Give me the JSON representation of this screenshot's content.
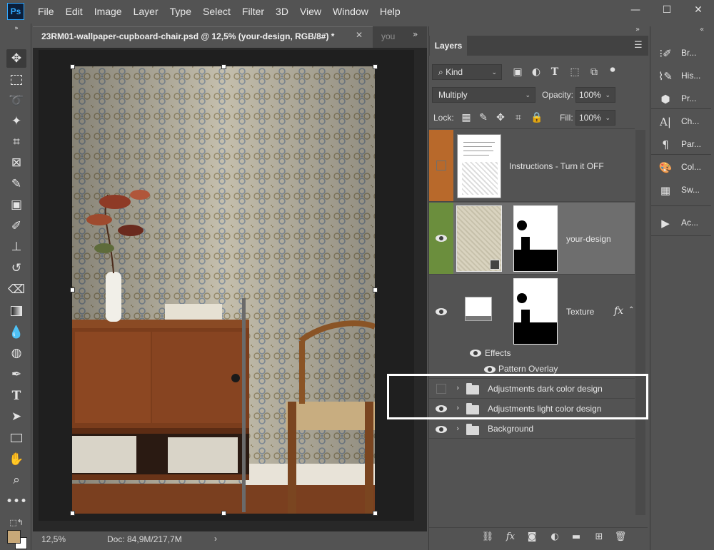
{
  "app": {
    "logo_text": "Ps"
  },
  "menu": [
    "File",
    "Edit",
    "Image",
    "Layer",
    "Type",
    "Select",
    "Filter",
    "3D",
    "View",
    "Window",
    "Help"
  ],
  "window_controls": {
    "minimize": "—",
    "maximize": "☐",
    "close": "✕"
  },
  "document": {
    "tab_title": "23RM01-wallpaper-cupboard-chair.psd @ 12,5% (your-design, RGB/8#) *",
    "tab_close": "✕",
    "second_tab": "yo­u",
    "second_tab_display": "you",
    "zoom": "12,5%",
    "doc_size": "Doc: 84,9M/217,7M",
    "status_arrow": "›"
  },
  "toolbar_icons": [
    "move-icon",
    "marquee-icon",
    "lasso-icon",
    "magic-wand-icon",
    "crop-icon",
    "frame-icon",
    "eyedropper-icon",
    "healing-icon",
    "brush-icon",
    "stamp-icon",
    "history-brush-icon",
    "eraser-icon",
    "gradient-icon",
    "blur-icon",
    "dodge-icon",
    "pen-icon",
    "type-icon",
    "path-select-icon",
    "rectangle-icon",
    "hand-icon",
    "zoom-icon",
    "more-tools-icon"
  ],
  "layers_panel": {
    "tab_label": "Layers",
    "kind_label": "Kind",
    "blend_mode": "Multiply",
    "opacity_label": "Opacity:",
    "opacity_value": "100%",
    "lock_label": "Lock:",
    "fill_label": "Fill:",
    "fill_value": "100%",
    "effects_label": "Effects",
    "pattern_overlay_label": "Pattern Overlay",
    "fx_label": "fx",
    "layers": [
      {
        "name": "Instructions - Turn it OFF",
        "visible": false,
        "color_tag": "#b8692b"
      },
      {
        "name": "your-design",
        "visible": true,
        "color_tag": "#6b8e3d",
        "selected": true
      },
      {
        "name": "Texture",
        "visible": true
      },
      {
        "name": "Adjustments dark color design",
        "visible": false,
        "type": "group"
      },
      {
        "name": "Adjustments light color design",
        "visible": true,
        "type": "group"
      },
      {
        "name": "Background",
        "visible": true,
        "type": "group"
      }
    ]
  },
  "right_dock": [
    {
      "label": "Br...",
      "icon": "brushes-icon"
    },
    {
      "label": "His...",
      "icon": "history-icon"
    },
    {
      "label": "Pr...",
      "icon": "properties-icon"
    },
    {
      "label": "Ch...",
      "icon": "character-icon"
    },
    {
      "label": "Par...",
      "icon": "paragraph-icon"
    },
    {
      "label": "Col...",
      "icon": "color-icon"
    },
    {
      "label": "Sw...",
      "icon": "swatches-icon"
    },
    {
      "label": "Ac...",
      "icon": "actions-icon"
    }
  ],
  "colors": {
    "accent_highlight": "#ffffff",
    "foreground_swatch": "#c8a878",
    "background_swatch": "#ffffff"
  }
}
